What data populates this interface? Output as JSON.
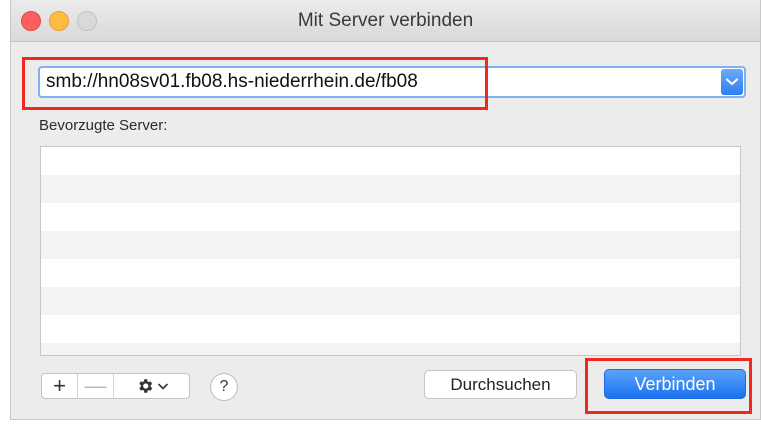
{
  "window": {
    "title": "Mit Server verbinden"
  },
  "address": {
    "value": "smb://hn08sv01.fb08.hs-niederrhein.de/fb08"
  },
  "favorites": {
    "label": "Bevorzugte Server:",
    "items": []
  },
  "toolbar": {
    "add_label": "+",
    "remove_label": "—",
    "gear_icon": "gear-icon",
    "help_label": "?"
  },
  "buttons": {
    "browse_label": "Durchsuchen",
    "connect_label": "Verbinden"
  },
  "colors": {
    "accent": "#2f7ff0",
    "highlight": "#ee2a1f"
  }
}
